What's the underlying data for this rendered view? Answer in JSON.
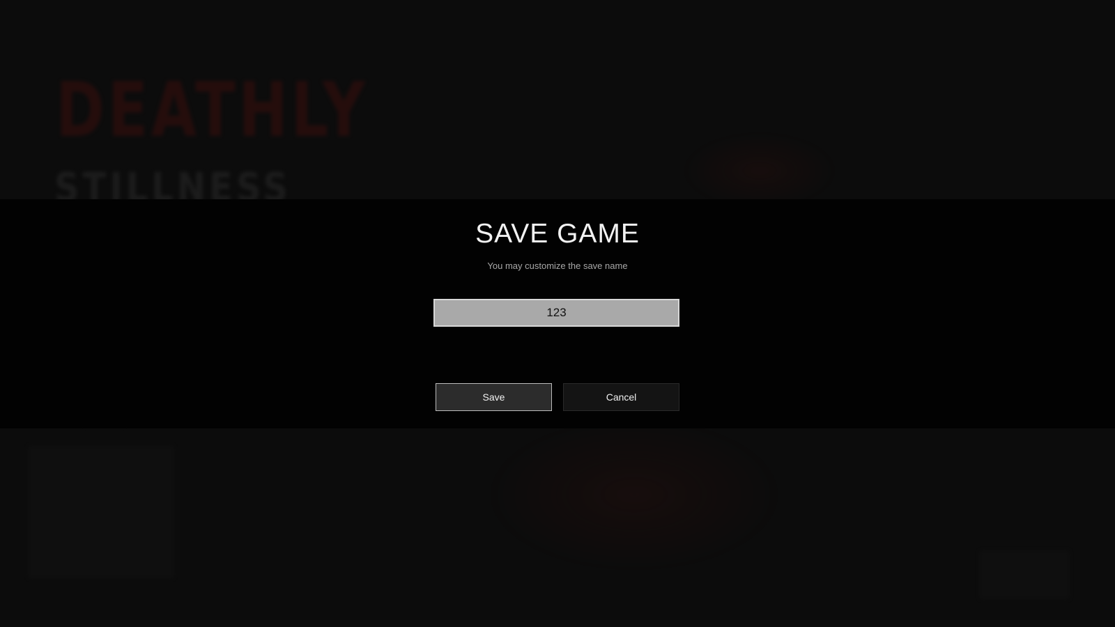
{
  "background": {
    "logo_line1": "DEATHLY",
    "logo_line2": "STILLNESS"
  },
  "dialog": {
    "title": "SAVE GAME",
    "subtitle": "You may customize the save name",
    "save_name_value": "123",
    "save_label": "Save",
    "cancel_label": "Cancel"
  },
  "colors": {
    "modal_background": "#020202",
    "field_background": "#a9a9a9",
    "save_button_background": "#2c2c2c",
    "cancel_button_background": "#141414",
    "logo_red": "#3a0f0d"
  }
}
